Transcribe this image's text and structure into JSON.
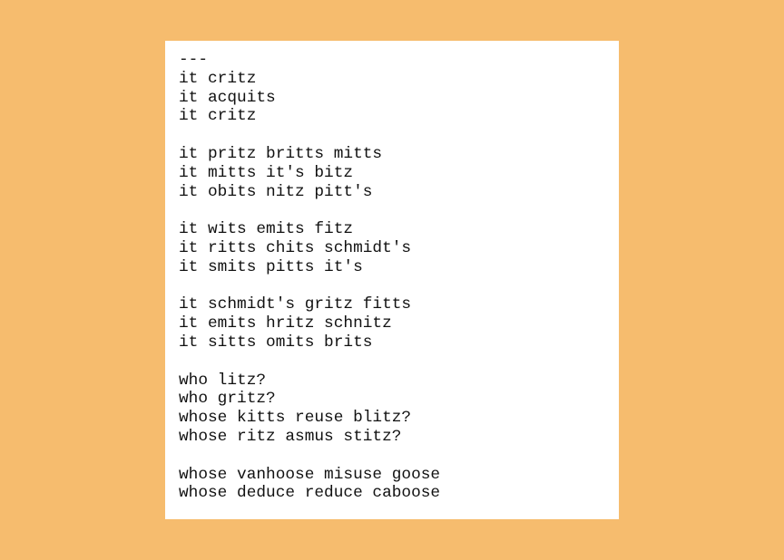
{
  "poem": {
    "lines": [
      "---",
      "it critz",
      "it acquits",
      "it critz",
      "",
      "it pritz britts mitts",
      "it mitts it's bitz",
      "it obits nitz pitt's",
      "",
      "it wits emits fitz",
      "it ritts chits schmidt's",
      "it smits pitts it's",
      "",
      "it schmidt's gritz fitts",
      "it emits hritz schnitz",
      "it sitts omits brits",
      "",
      "who litz?",
      "who gritz?",
      "whose kitts reuse blitz?",
      "whose ritz asmus stitz?",
      "",
      "whose vanhoose misuse goose",
      "whose deduce reduce caboose"
    ]
  },
  "colors": {
    "background": "#f6bc6e",
    "panel": "#ffffff",
    "text": "#111111"
  }
}
